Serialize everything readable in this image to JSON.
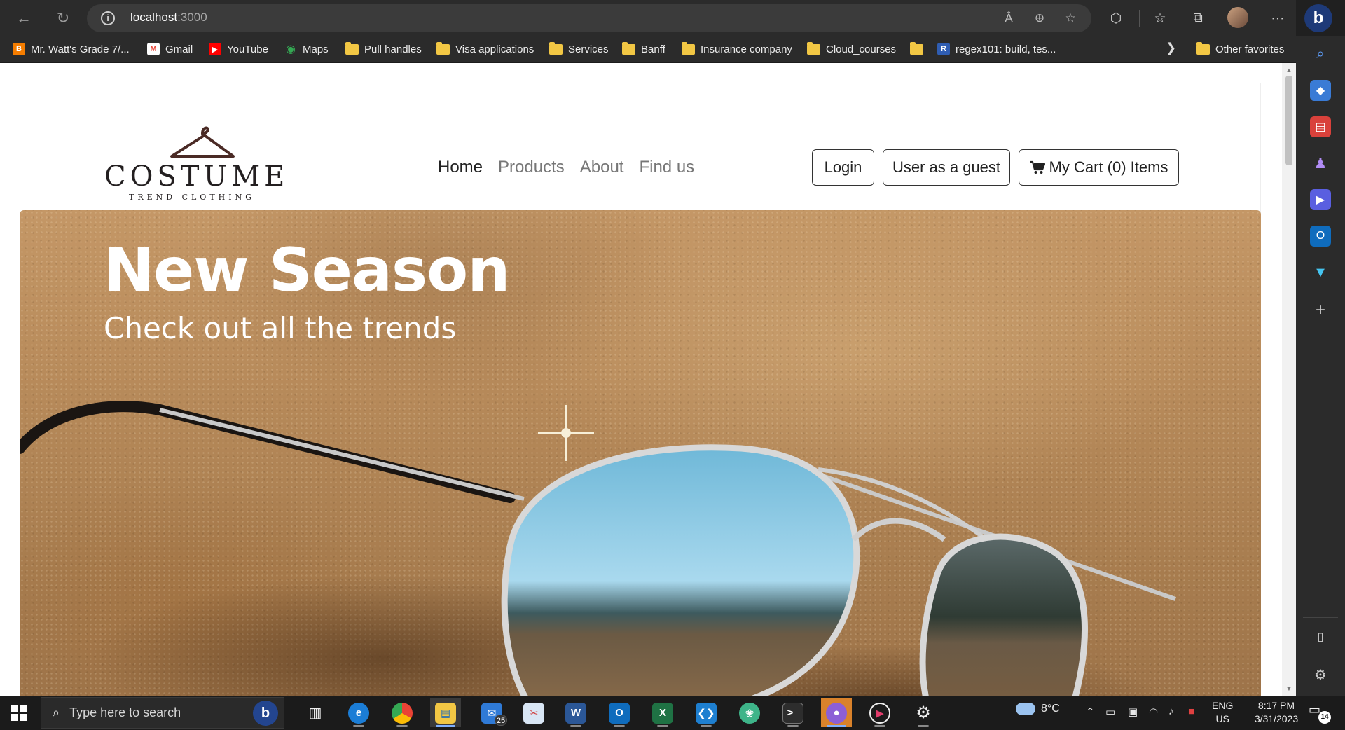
{
  "browser": {
    "url_host": "localhost",
    "url_port": ":3000"
  },
  "favorites": [
    {
      "label": "Mr. Watt's Grade 7/...",
      "icon": "blogger-icon",
      "color": "#f57d00"
    },
    {
      "label": "Gmail",
      "icon": "gmail-icon",
      "color": "#ea4335"
    },
    {
      "label": "YouTube",
      "icon": "youtube-icon",
      "color": "#ff0000"
    },
    {
      "label": "Maps",
      "icon": "maps-icon",
      "color": "#34a853"
    },
    {
      "label": "Pull handles",
      "icon": "folder-icon"
    },
    {
      "label": "Visa applications",
      "icon": "folder-icon"
    },
    {
      "label": "Services",
      "icon": "folder-icon"
    },
    {
      "label": "Banff",
      "icon": "folder-icon"
    },
    {
      "label": "Insurance company",
      "icon": "folder-icon"
    },
    {
      "label": "Cloud_courses",
      "icon": "folder-icon"
    },
    {
      "label": "",
      "icon": "folder-icon"
    },
    {
      "label": "regex101: build, tes...",
      "icon": "regex101-icon",
      "badge": "R",
      "color": "#2f5db2"
    }
  ],
  "other_favorites": "Other favorites",
  "site": {
    "logo_word": "COSTUME",
    "logo_tagline": "TREND CLOTHING",
    "nav": [
      {
        "label": "Home",
        "active": true
      },
      {
        "label": "Products",
        "active": false
      },
      {
        "label": "About",
        "active": false
      },
      {
        "label": "Find us",
        "active": false
      }
    ],
    "login_label": "Login",
    "guest_label": "User as a guest",
    "cart_label": "My Cart (0) Items",
    "hero_title": "New Season",
    "hero_subtitle": "Check out all the trends"
  },
  "taskbar": {
    "search_placeholder": "Type here to search",
    "mail_badge": "25",
    "weather_temp": "8°C",
    "lang_top": "ENG",
    "lang_bottom": "US",
    "time": "8:17 PM",
    "date": "3/31/2023",
    "notification_count": "14"
  },
  "colors": {
    "accent": "#7fb0ff",
    "folder": "#f2c744",
    "bing": "#23458f"
  }
}
